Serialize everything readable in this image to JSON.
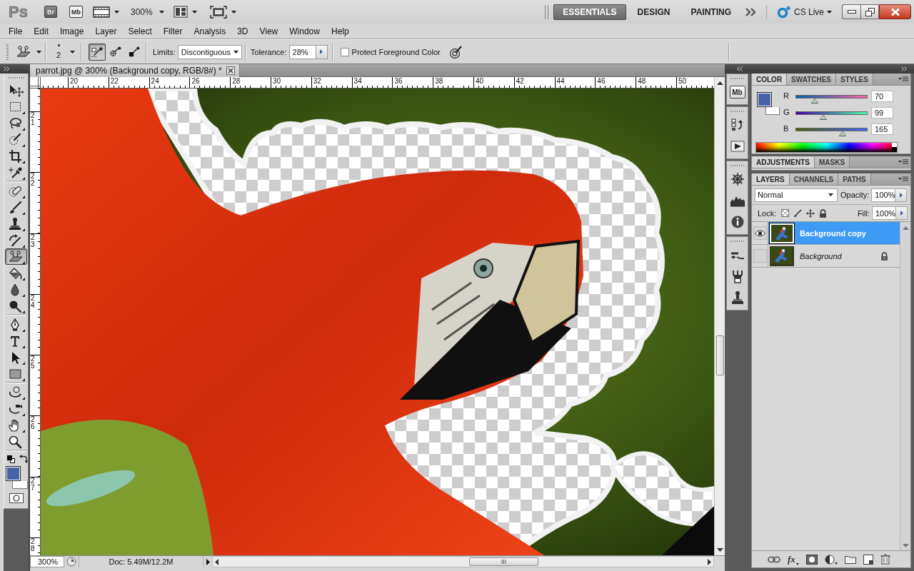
{
  "app_bar": {
    "logo": "Ps",
    "bridge_button": "Br",
    "mini_bridge_button": "Mb",
    "zoom_level": "300%",
    "workspaces": [
      {
        "label": "ESSENTIALS",
        "selected": true
      },
      {
        "label": "DESIGN",
        "selected": false
      },
      {
        "label": "PAINTING",
        "selected": false
      }
    ],
    "cs_live": "CS Live"
  },
  "menu": [
    "File",
    "Edit",
    "Image",
    "Layer",
    "Select",
    "Filter",
    "Analysis",
    "3D",
    "View",
    "Window",
    "Help"
  ],
  "options_bar": {
    "brush_size": "2",
    "sampling_buttons": [
      {
        "kind": "continuous",
        "selected": true
      },
      {
        "kind": "once",
        "selected": false
      },
      {
        "kind": "background_swatch",
        "selected": false
      }
    ],
    "limits_label": "Limits:",
    "limits_value": "Discontiguous",
    "tolerance_label": "Tolerance:",
    "tolerance_value": "28%",
    "protect_foreground": {
      "label": "Protect Foreground Color",
      "checked": false
    }
  },
  "toolbox": {
    "tool_groups": [
      [
        {
          "kind": "move",
          "selected": false
        },
        {
          "kind": "marquee",
          "selected": false
        },
        {
          "kind": "lasso",
          "selected": false
        },
        {
          "kind": "quick_selection",
          "selected": false
        },
        {
          "kind": "crop",
          "selected": false
        },
        {
          "kind": "eyedropper",
          "selected": false
        }
      ],
      [
        {
          "kind": "spot_healing",
          "selected": false
        },
        {
          "kind": "brush",
          "selected": false
        },
        {
          "kind": "clone_stamp",
          "selected": false
        },
        {
          "kind": "history_brush",
          "selected": false
        },
        {
          "kind": "eraser",
          "selected": true
        },
        {
          "kind": "paint_bucket",
          "selected": false
        },
        {
          "kind": "blur",
          "selected": false
        },
        {
          "kind": "dodge",
          "selected": false
        }
      ],
      [
        {
          "kind": "pen",
          "selected": false
        },
        {
          "kind": "type",
          "selected": false
        },
        {
          "kind": "path_selection",
          "selected": false
        },
        {
          "kind": "rectangle",
          "selected": false
        }
      ],
      [
        {
          "kind": "rotate_3d",
          "selected": false
        },
        {
          "kind": "orbit_3d",
          "selected": false
        },
        {
          "kind": "hand",
          "selected": false
        },
        {
          "kind": "zoom",
          "selected": false
        }
      ]
    ]
  },
  "document": {
    "tab_title": "parrot.jpg @ 300% (Background copy, RGB/8#) *",
    "top_ruler": [
      "20",
      "22",
      "24",
      "26",
      "28",
      "30",
      "32",
      "34",
      "36",
      "38",
      "40",
      "42",
      "44",
      "46",
      "48",
      "50"
    ],
    "left_ruler": [
      "21",
      "22",
      "23",
      "24",
      "25",
      "26",
      "27",
      "28"
    ],
    "zoom_level": "300%",
    "doc_info": "Doc: 5.49M/12.2M"
  },
  "dock": {
    "mini_bridge_button": "Mb"
  },
  "color_panel": {
    "tabs": [
      {
        "label": "COLOR",
        "selected": true
      },
      {
        "label": "SWATCHES",
        "selected": false
      },
      {
        "label": "STYLES",
        "selected": false
      }
    ],
    "channels": [
      {
        "kind": "red",
        "label": "R",
        "level": 0.27,
        "value": "70"
      },
      {
        "kind": "green",
        "label": "G",
        "level": 0.39,
        "value": "99"
      },
      {
        "kind": "blue",
        "label": "B",
        "level": 0.65,
        "value": "165"
      }
    ]
  },
  "adjustments_panel": {
    "tabs": [
      {
        "label": "ADJUSTMENTS",
        "selected": true
      },
      {
        "label": "MASKS",
        "selected": false
      }
    ]
  },
  "layers_panel": {
    "tabs": [
      {
        "label": "LAYERS",
        "selected": true
      },
      {
        "label": "CHANNELS",
        "selected": false
      },
      {
        "label": "PATHS",
        "selected": false
      }
    ],
    "blend_mode": "Normal",
    "opacity_label": "Opacity:",
    "opacity_value": "100%",
    "lock_label": "Lock:",
    "fill_label": "Fill:",
    "fill_value": "100%",
    "layers": [
      {
        "name": "Background copy",
        "kind": "normal",
        "selected": true,
        "visible": true,
        "locked": false
      },
      {
        "name": "Background",
        "kind": "background",
        "selected": false,
        "visible": false,
        "locked": true
      }
    ],
    "footer_fx": "fx"
  }
}
